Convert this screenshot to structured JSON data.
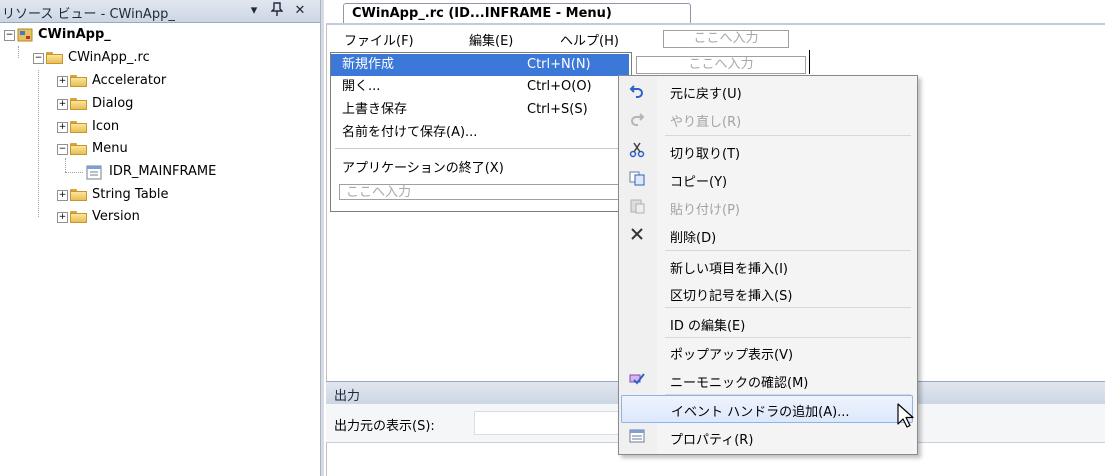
{
  "left_pane": {
    "title": "リソース ビュー - CWinApp_",
    "pin_glyph": "▾",
    "dock_glyph": "ᚯ",
    "close_glyph": "✕",
    "tree": {
      "project": "CWinApp_",
      "rc_file": "CWinApp_.rc",
      "folders": {
        "accelerator": "Accelerator",
        "dialog": "Dialog",
        "icon": "Icon",
        "menu": "Menu",
        "string_table": "String Table",
        "version": "Version"
      },
      "menu_resource": "IDR_MAINFRAME"
    }
  },
  "editor": {
    "tab_label": "CWinApp_.rc (ID...INFRAME - Menu)",
    "menubar": {
      "file": "ファイル(F)",
      "edit": "編集(E)",
      "help": "ヘルプ(H)",
      "type_here": "ここへ入力"
    },
    "file_menu": {
      "items": {
        "new": {
          "label": "新規作成",
          "shortcut": "Ctrl+N(N)"
        },
        "open": {
          "label": "開く...",
          "shortcut": "Ctrl+O(O)"
        },
        "save": {
          "label": "上書き保存",
          "shortcut": "Ctrl+S(S)"
        },
        "save_as": {
          "label": "名前を付けて保存(A)..."
        },
        "exit": {
          "label": "アプリケーションの終了(X)"
        }
      },
      "type_here_side": "ここへ入力",
      "type_here_bottom": "ここへ入力"
    }
  },
  "output": {
    "title": "出力",
    "source_label": "出力元の表示(S):"
  },
  "context_menu": {
    "items": {
      "undo": "元に戻す(U)",
      "redo": "やり直し(R)",
      "cut": "切り取り(T)",
      "copy": "コピー(Y)",
      "paste": "貼り付け(P)",
      "delete": "削除(D)",
      "insert_new": "新しい項目を挿入(I)",
      "insert_separator": "区切り記号を挿入(S)",
      "edit_ids": "ID の編集(E)",
      "popup_view": "ポップアップ表示(V)",
      "check_mnemonics": "ニーモニックの確認(M)",
      "add_event_handler": "イベント ハンドラの追加(A)...",
      "properties": "プロパティ(R)"
    },
    "icons": {
      "undo": "undo-icon",
      "redo": "redo-icon",
      "cut": "scissors-icon",
      "copy": "copy-icon",
      "paste": "paste-icon",
      "delete": "delete-icon",
      "check_mnemonics": "check-mnemonics-icon",
      "properties": "properties-icon"
    },
    "highlight_color": "#dce8fb"
  },
  "colors": {
    "selection": "#3c78d8",
    "title_bar": "#ccd6e4",
    "folder": "#e9bf55"
  }
}
